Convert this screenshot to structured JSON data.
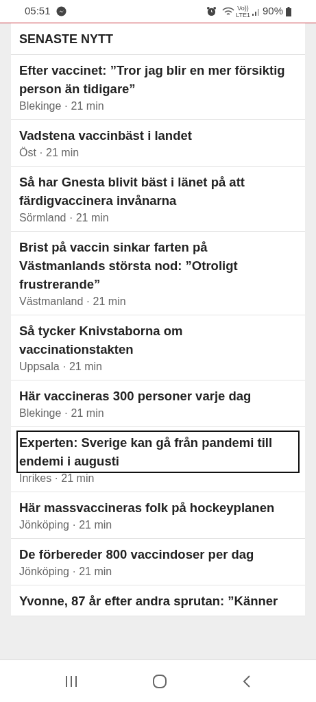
{
  "status_bar": {
    "time": "05:51",
    "network_top": "Vo))",
    "network_bottom": "LTE1",
    "battery": "90%"
  },
  "section": {
    "title": "SENASTE NYTT"
  },
  "articles": [
    {
      "title": "Efter vaccinet: ”Tror jag blir en mer försiktig person än tidigare”",
      "meta": "Blekinge · 21 min",
      "focused": false
    },
    {
      "title": "Vadstena vaccinbäst i landet",
      "meta": "Öst · 21 min",
      "focused": false
    },
    {
      "title": "Så har Gnesta blivit bäst i länet på att färdigvaccinera invånarna",
      "meta": "Sörmland · 21 min",
      "focused": false
    },
    {
      "title": "Brist på vaccin sinkar farten på Västmanlands största nod: ”Otroligt frustrerande”",
      "meta": "Västmanland · 21 min",
      "focused": false
    },
    {
      "title": "Så tycker Knivstaborna om vaccinationstakten",
      "meta": "Uppsala · 21 min",
      "focused": false
    },
    {
      "title": "Här vaccineras 300 personer varje dag",
      "meta": "Blekinge · 21 min",
      "focused": false
    },
    {
      "title": "Experten: Sverige kan gå från pandemi till endemi i augusti",
      "meta": "Inrikes · 21 min",
      "focused": true
    },
    {
      "title": "Här massvaccineras folk på hockeyplanen",
      "meta": "Jönköping · 21 min",
      "focused": false
    },
    {
      "title": "De förbereder 800 vaccindoser per dag",
      "meta": "Jönköping · 21 min",
      "focused": false
    },
    {
      "title": "Yvonne, 87 år efter andra sprutan: ”Känner",
      "focused": false
    }
  ]
}
